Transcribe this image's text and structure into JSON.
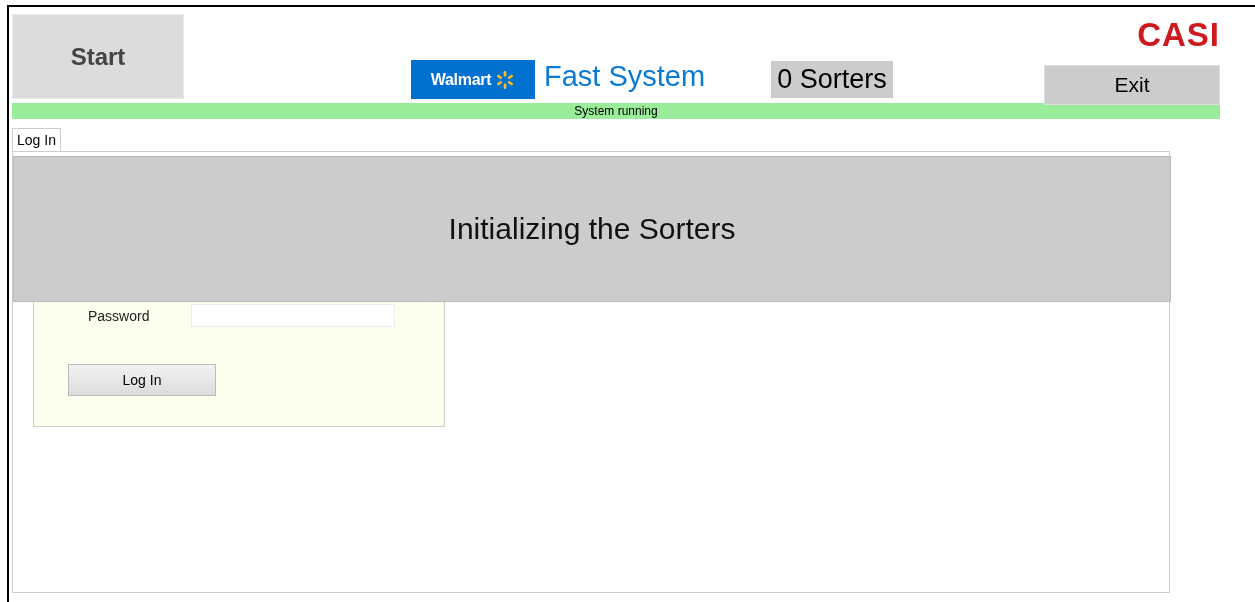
{
  "header": {
    "start_button": "Start",
    "brand": "Walmart",
    "title": "Fast System",
    "sorters": "0 Sorters",
    "logo": "CASI",
    "exit_button": "Exit"
  },
  "status_bar": {
    "text": "System running"
  },
  "tabs": [
    {
      "label": "Log In",
      "selected": true
    }
  ],
  "login": {
    "password_label": "Password",
    "button": "Log In"
  },
  "overlay": {
    "message": "Initializing the Sorters"
  }
}
